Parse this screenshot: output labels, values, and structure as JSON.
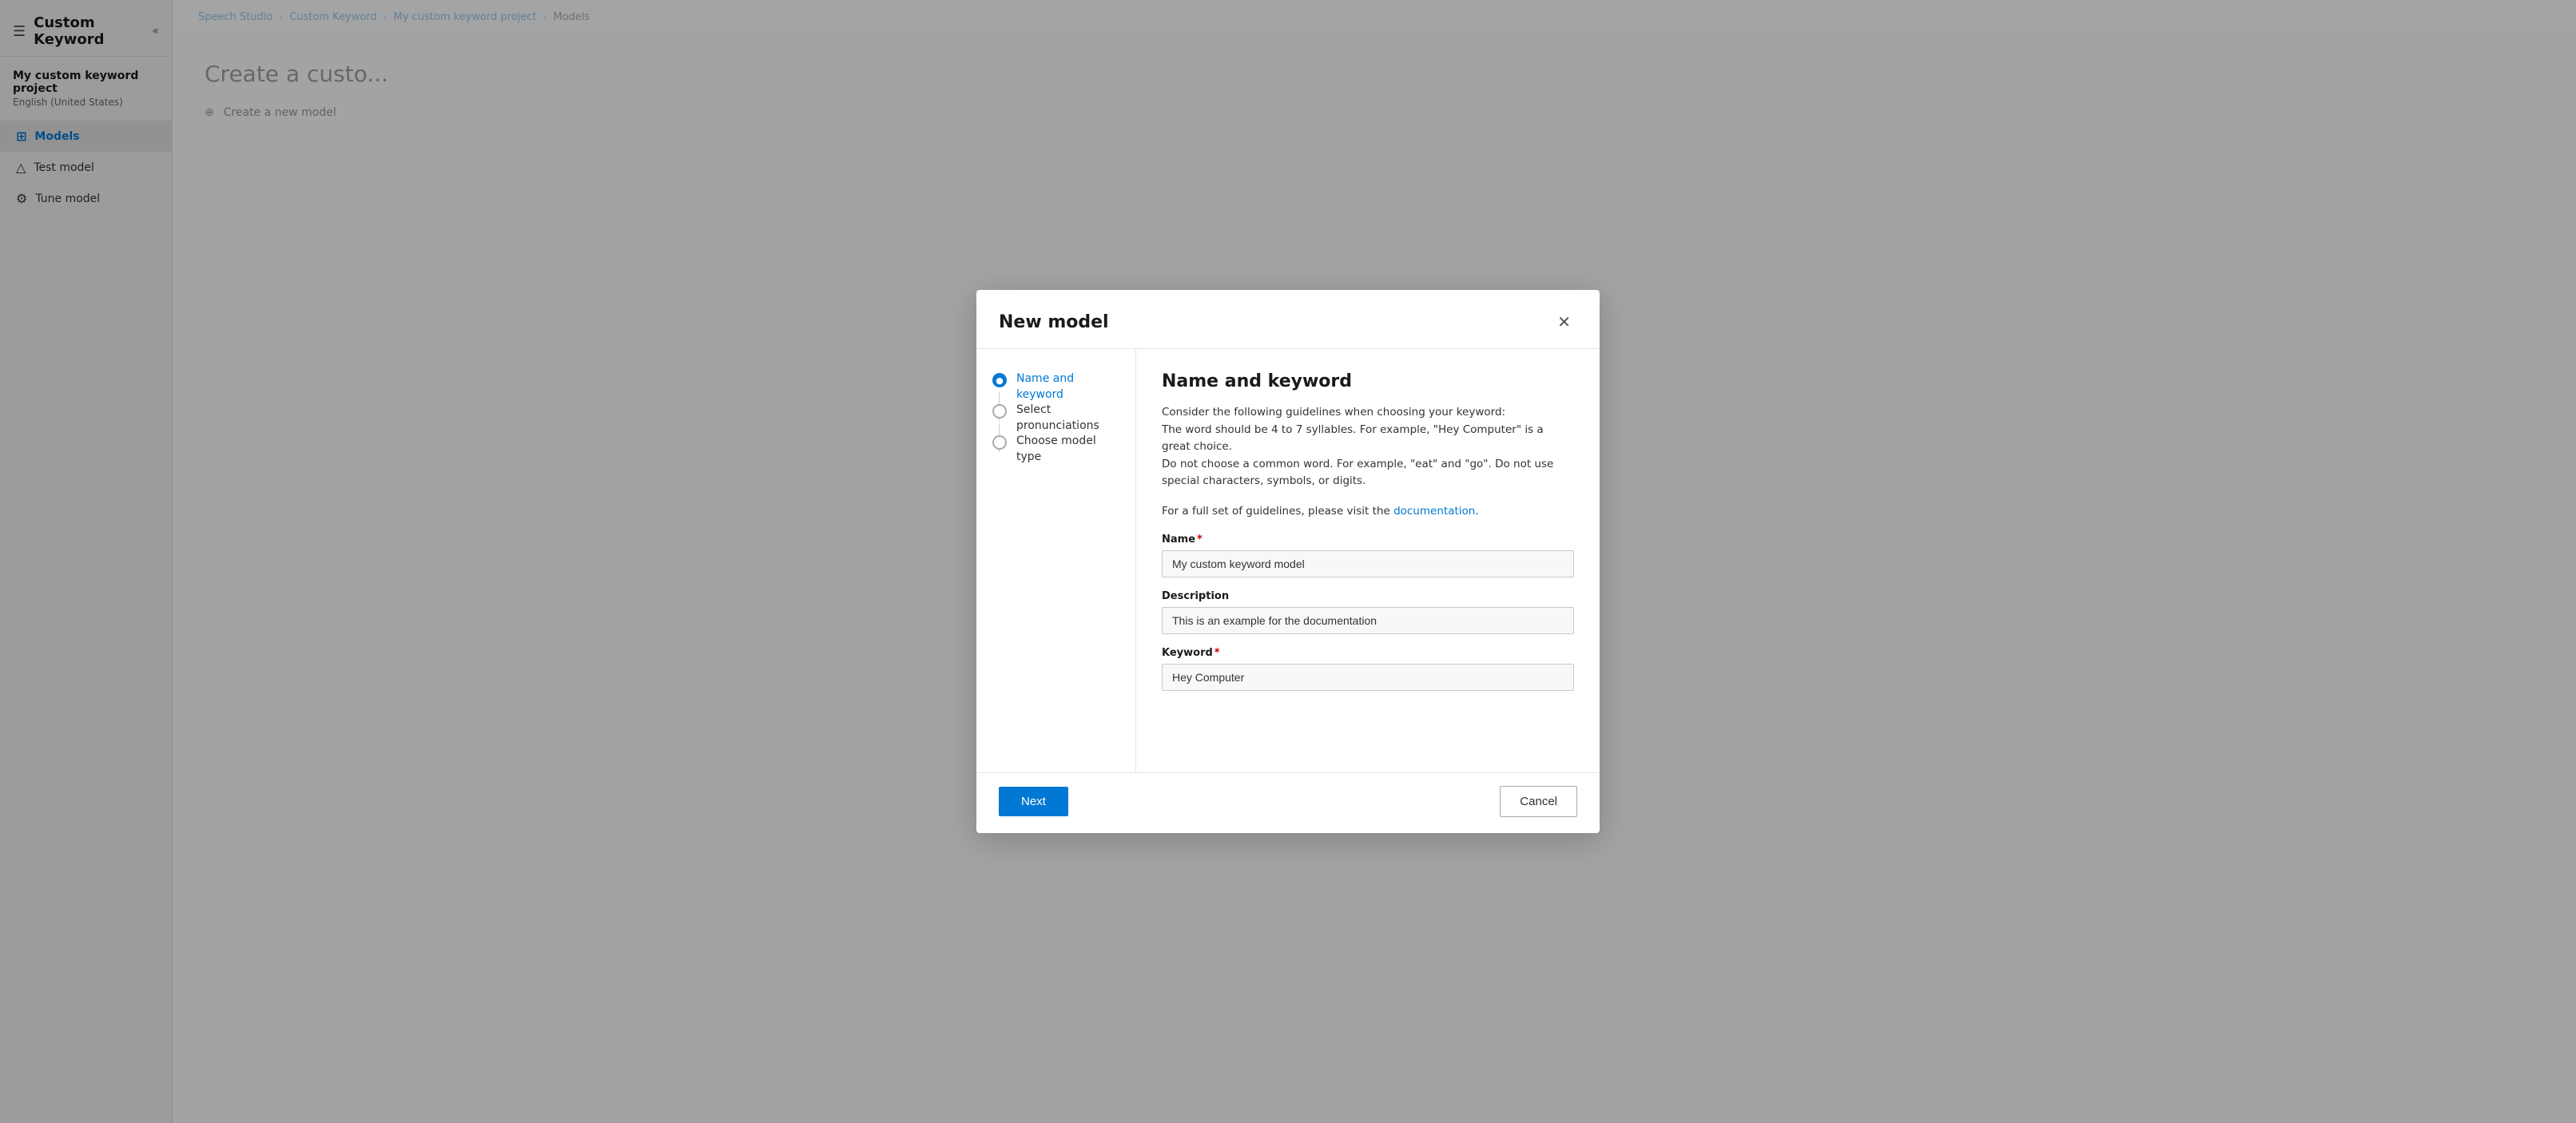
{
  "sidebar": {
    "collapse_icon": "«",
    "hamburger": "☰",
    "title": "Custom Keyword",
    "project": {
      "name": "My custom keyword project",
      "language": "English (United States)"
    },
    "nav_items": [
      {
        "id": "models",
        "label": "Models",
        "icon": "⊞",
        "active": true
      },
      {
        "id": "test-model",
        "label": "Test model",
        "icon": "△"
      },
      {
        "id": "tune-model",
        "label": "Tune model",
        "icon": "⚙"
      }
    ]
  },
  "breadcrumb": {
    "items": [
      {
        "label": "Speech Studio",
        "active": false
      },
      {
        "label": "Custom Keyword",
        "active": false
      },
      {
        "label": "My custom keyword project",
        "active": false
      },
      {
        "label": "Models",
        "active": true
      }
    ],
    "separator": "›"
  },
  "main": {
    "page_title": "Create a custo...",
    "create_button_label": "Create a new model"
  },
  "dialog": {
    "title": "New model",
    "close_icon": "✕",
    "steps": [
      {
        "id": "name-and-keyword",
        "label": "Name and keyword",
        "state": "active"
      },
      {
        "id": "select-pronunciations",
        "label": "Select pronunciations",
        "state": "inactive"
      },
      {
        "id": "choose-model-type",
        "label": "Choose model type",
        "state": "inactive"
      }
    ],
    "content": {
      "title": "Name and keyword",
      "guidelines": {
        "line1": "Consider the following guidelines when choosing your keyword:",
        "line2": "The word should be 4 to 7 syllables. For example, \"Hey Computer\" is a great choice.",
        "line3": "Do not choose a common word. For example, \"eat\" and \"go\". Do not use special characters, symbols, or digits.",
        "line4_prefix": "For a full set of guidelines, please visit the ",
        "link_text": "documentation",
        "line4_suffix": "."
      },
      "fields": {
        "name": {
          "label": "Name",
          "required": true,
          "value": "My custom keyword model",
          "placeholder": "My custom keyword model"
        },
        "description": {
          "label": "Description",
          "required": false,
          "value": "This is an example for the documentation",
          "placeholder": "This is an example for the documentation"
        },
        "keyword": {
          "label": "Keyword",
          "required": true,
          "value": "Hey Computer",
          "placeholder": "Hey Computer"
        }
      }
    },
    "footer": {
      "next_label": "Next",
      "cancel_label": "Cancel"
    }
  }
}
